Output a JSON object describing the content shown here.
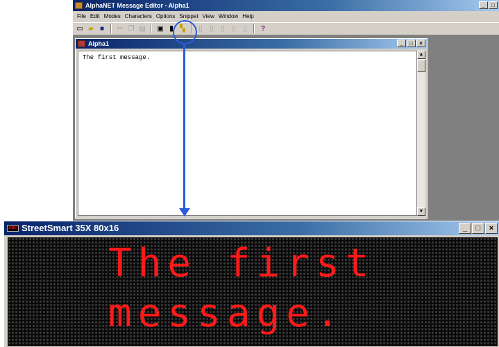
{
  "editor_window": {
    "title": "AlphaNET Message Editor - Alpha1",
    "menu": [
      "File",
      "Edit",
      "Modes",
      "Characters",
      "Options",
      "Snippet",
      "View",
      "Window",
      "Help"
    ],
    "child_title": "Alpha1",
    "text": "The first message."
  },
  "toolbar_icons": [
    "new-file-icon",
    "open-folder-icon",
    "save-icon",
    "cut-icon",
    "copy-icon",
    "paste-icon",
    "print-icon",
    "send-to-sign-icon",
    "preview-icon",
    "frame-icon-1",
    "frame-icon-2",
    "frame-icon-3",
    "frame-icon-4",
    "frame-icon-5",
    "help-icon"
  ],
  "sign_window": {
    "title": "StreetSmart 35X 80x16",
    "icon_text": "ABC",
    "line1": "The first",
    "line2": "message."
  },
  "caption_buttons": {
    "minimize": "_",
    "maximize": "□",
    "close": "×"
  },
  "colors": {
    "title_start": "#0a246a",
    "led_on": "#ff1a1a",
    "callout": "#2b5cd9"
  }
}
